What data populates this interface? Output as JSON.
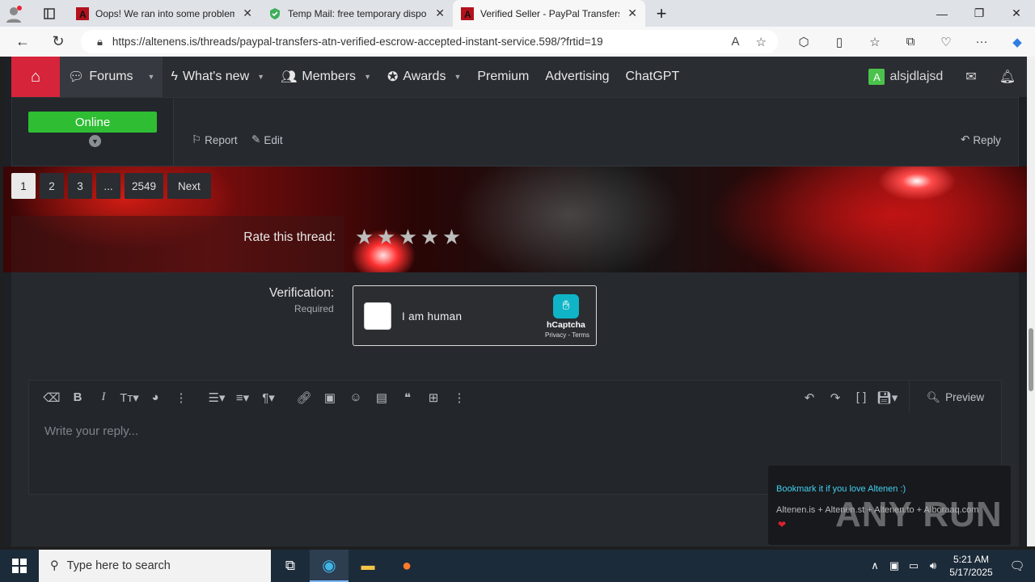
{
  "browser": {
    "tabs": [
      {
        "title": "Oops! We ran into some problems.",
        "icon": "altenen-favicon"
      },
      {
        "title": "Temp Mail: free temporary dispo...",
        "icon": "shield-check-favicon"
      },
      {
        "title": "Verified Seller - PayPal Transfers",
        "icon": "altenen-favicon"
      }
    ],
    "url": "https://altenens.is/threads/paypal-transfers-atn-verified-escrow-accepted-instant-service.598/?frtid=19",
    "new_tab": "+"
  },
  "site_nav": {
    "items": [
      {
        "label": "Forums",
        "caret": true
      },
      {
        "label": "What's new",
        "caret": true
      },
      {
        "label": "Members",
        "caret": true
      },
      {
        "label": "Awards",
        "caret": true
      },
      {
        "label": "Premium",
        "caret": false
      },
      {
        "label": "Advertising",
        "caret": false
      },
      {
        "label": "ChatGPT",
        "caret": false
      }
    ],
    "user": {
      "avatar_letter": "A",
      "name": "alsjdlajsd"
    }
  },
  "post": {
    "status": "Online",
    "report": "Report",
    "edit": "Edit",
    "reply": "Reply"
  },
  "pagination": {
    "pages": [
      "1",
      "2",
      "3",
      "...",
      "2549"
    ],
    "current": "1",
    "next": "Next"
  },
  "rating": {
    "label": "Rate this thread:",
    "max_stars": 5,
    "value": 0
  },
  "verification": {
    "label": "Verification:",
    "required": "Required",
    "captcha_text": "I am human",
    "captcha_brand": "hCaptcha",
    "captcha_terms": "Privacy - Terms"
  },
  "editor": {
    "placeholder": "Write your reply...",
    "preview": "Preview"
  },
  "toast": {
    "line1": "Bookmark it if you love Altenen :)",
    "line2": "Altenen.is + Altenen.st + Altenen.to + Alboraaq.com"
  },
  "watermark": "ANY RUN",
  "taskbar": {
    "search_placeholder": "Type here to search",
    "time": "5:21 AM",
    "date": "5/17/2025"
  }
}
